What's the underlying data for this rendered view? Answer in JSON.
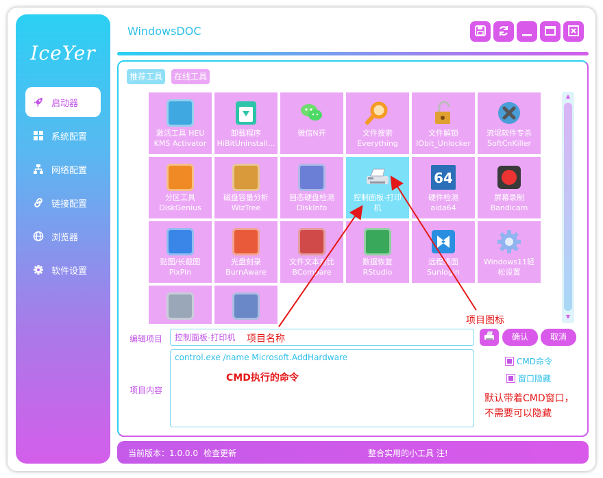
{
  "app": {
    "logo": "IceYer",
    "title": "WindowsDOC"
  },
  "sidebar": {
    "items": [
      {
        "label": "启动器",
        "icon": "rocket-icon",
        "active": true
      },
      {
        "label": "系统配置",
        "icon": "windows-icon"
      },
      {
        "label": "网络配置",
        "icon": "network-icon"
      },
      {
        "label": "链接配置",
        "icon": "link-icon"
      },
      {
        "label": "浏览器",
        "icon": "globe-icon"
      },
      {
        "label": "软件设置",
        "icon": "gear-icon"
      }
    ]
  },
  "tabs": [
    {
      "label": "推荐工具",
      "active": true
    },
    {
      "label": "在线工具",
      "active": false
    }
  ],
  "tools": [
    {
      "name": "激活工具 HEU",
      "sub": "KMS Activator",
      "icon": "cube-icon",
      "color": "#3fa8e0"
    },
    {
      "name": "卸载程序",
      "sub": "HiBitUninstall...",
      "icon": "recycle-bin-icon",
      "color": "#2ec4a9"
    },
    {
      "name": "微信N开",
      "sub": "",
      "icon": "wechat-icon",
      "color": "#4cd964"
    },
    {
      "name": "文件搜索",
      "sub": "Everything",
      "icon": "magnifier-icon",
      "color": "#f59a23"
    },
    {
      "name": "文件解锁",
      "sub": "IObit_Unlocker",
      "icon": "padlock-icon",
      "color": "#e0a030"
    },
    {
      "name": "流氓软件专杀",
      "sub": "SoftCnKiller",
      "icon": "kill-icon",
      "color": "#4a9ed8"
    },
    {
      "name": "分区工具",
      "sub": "DiskGenius",
      "icon": "diskgenius-icon",
      "color": "#f08a24"
    },
    {
      "name": "磁盘容量分析",
      "sub": "WizTree",
      "icon": "wiztree-icon",
      "color": "#d89a3a"
    },
    {
      "name": "固态硬盘检测",
      "sub": "DiskInfo",
      "icon": "harddisk-icon",
      "color": "#6b7fd6"
    },
    {
      "name": "控制面板-打印",
      "sub": "机",
      "icon": "printer-icon",
      "color": "#8896a6",
      "selected": true
    },
    {
      "name": "硬件检测",
      "sub": "aida64",
      "icon": "aida64-icon",
      "color": "#2a6fb8"
    },
    {
      "name": "屏幕录制",
      "sub": "Bandicam",
      "icon": "record-icon",
      "color": "#d33"
    },
    {
      "name": "贴图/长截图",
      "sub": "PixPin",
      "icon": "pixpin-icon",
      "color": "#3a86e8"
    },
    {
      "name": "光盘刻录",
      "sub": "BurnAware",
      "icon": "burn-icon",
      "color": "#e85a3a"
    },
    {
      "name": "文件文本对比",
      "sub": "BCompare",
      "icon": "compare-icon",
      "color": "#d04a4a"
    },
    {
      "name": "数据恢复",
      "sub": "RStudio",
      "icon": "restore-icon",
      "color": "#3aa85a"
    },
    {
      "name": "远程桌面",
      "sub": "Sunlogin",
      "icon": "remote-icon",
      "color": "#2a8fe0"
    },
    {
      "name": "Windows11轻",
      "sub": "松设置",
      "icon": "gear-icon",
      "color": "#5a8ee8"
    },
    {
      "name": "",
      "sub": "",
      "icon": "settings-check-icon",
      "color": "#9aa7b8"
    },
    {
      "name": "",
      "sub": "",
      "icon": "file-export-icon",
      "color": "#6a88c8"
    }
  ],
  "editor": {
    "edit_label": "编辑项目",
    "content_label": "项目内容",
    "name_value": "控制面板-打印机",
    "content_value": "control.exe /name Microsoft.AddHardware",
    "confirm": "确认",
    "cancel": "取消",
    "cmd_label": "CMD命令",
    "hide_label": "窗口隐藏"
  },
  "annotations": {
    "icon_note": "项目图标",
    "name_note": "项目名称",
    "cmd_note": "CMD执行的命令",
    "hide_note_1": "默认带着CMD窗口，",
    "hide_note_2": "不需要可以隐藏"
  },
  "status": {
    "version": "当前版本：1.0.0.0",
    "check_update": "检查更新",
    "slogan": "整合实用的小工具 注!"
  },
  "colors": {
    "accent_pink": "#d95aea",
    "accent_cyan": "#2bd0f2",
    "tile": "#eba7f5",
    "tile_selected": "#7be0f8",
    "annotation": "#e41818"
  }
}
